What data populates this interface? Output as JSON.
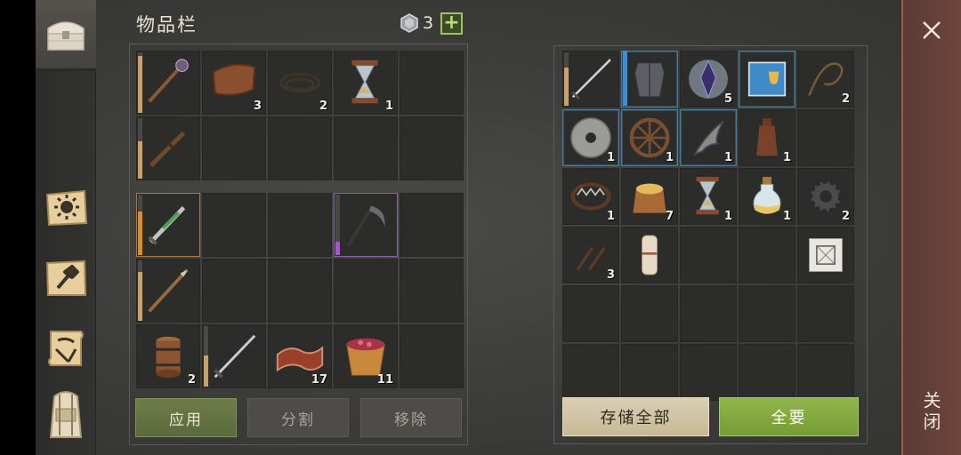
{
  "header": {
    "title": "物品栏",
    "gem_count": "3",
    "plus_label": "+"
  },
  "inventory": {
    "slots": [
      {
        "icon": "mace-icon",
        "count": ""
      },
      {
        "icon": "leather-icon",
        "count": "3"
      },
      {
        "icon": "rope-icon",
        "count": "2"
      },
      {
        "icon": "hourglass-icon",
        "count": "1"
      },
      {
        "icon": "",
        "count": ""
      },
      {
        "icon": "crossbow-icon",
        "count": ""
      },
      {
        "icon": "",
        "count": ""
      },
      {
        "icon": "",
        "count": ""
      },
      {
        "icon": "",
        "count": ""
      },
      {
        "icon": "",
        "count": ""
      }
    ],
    "equip_slots": [
      {
        "icon": "poison-dagger-icon",
        "count": ""
      },
      {
        "icon": "",
        "count": ""
      },
      {
        "icon": "",
        "count": ""
      },
      {
        "icon": "scythe-icon",
        "count": ""
      },
      {
        "icon": "",
        "count": ""
      },
      {
        "icon": "spear-icon",
        "count": ""
      },
      {
        "icon": "",
        "count": ""
      },
      {
        "icon": "",
        "count": ""
      },
      {
        "icon": "",
        "count": ""
      },
      {
        "icon": "",
        "count": ""
      },
      {
        "icon": "barrel-icon",
        "count": "2"
      },
      {
        "icon": "sword-icon",
        "count": ""
      },
      {
        "icon": "bacon-icon",
        "count": "17"
      },
      {
        "icon": "berry-bucket-icon",
        "count": "11"
      },
      {
        "icon": "",
        "count": ""
      }
    ]
  },
  "storage": {
    "slots": [
      {
        "icon": "longsword-icon",
        "count": ""
      },
      {
        "icon": "armor-icon",
        "count": ""
      },
      {
        "icon": "crystal-icon",
        "count": "5"
      },
      {
        "icon": "book-icon",
        "count": ""
      },
      {
        "icon": "whip-icon",
        "count": "2"
      },
      {
        "icon": "grindstone-icon",
        "count": "1"
      },
      {
        "icon": "wheel-icon",
        "count": "1"
      },
      {
        "icon": "bone-blade-icon",
        "count": "1"
      },
      {
        "icon": "bottle-icon",
        "count": "1"
      },
      {
        "icon": "",
        "count": ""
      },
      {
        "icon": "bear-trap-icon",
        "count": "1"
      },
      {
        "icon": "grain-sack-icon",
        "count": "7"
      },
      {
        "icon": "hourglass-icon",
        "count": "1"
      },
      {
        "icon": "potion-icon",
        "count": "1"
      },
      {
        "icon": "gear-icon",
        "count": "2"
      },
      {
        "icon": "nails-icon",
        "count": "3"
      },
      {
        "icon": "scroll-icon",
        "count": ""
      },
      {
        "icon": "",
        "count": ""
      },
      {
        "icon": "",
        "count": ""
      },
      {
        "icon": "blueprint-icon",
        "count": ""
      }
    ]
  },
  "buttons": {
    "apply": "应用",
    "split": "分割",
    "remove": "移除",
    "store_all": "存储全部",
    "take_all": "全要"
  },
  "close": {
    "label": "关闭"
  },
  "colors": {
    "accent_green": "#8fb54a",
    "close_red": "#6d453a",
    "store_beige": "#d9cfb4"
  }
}
